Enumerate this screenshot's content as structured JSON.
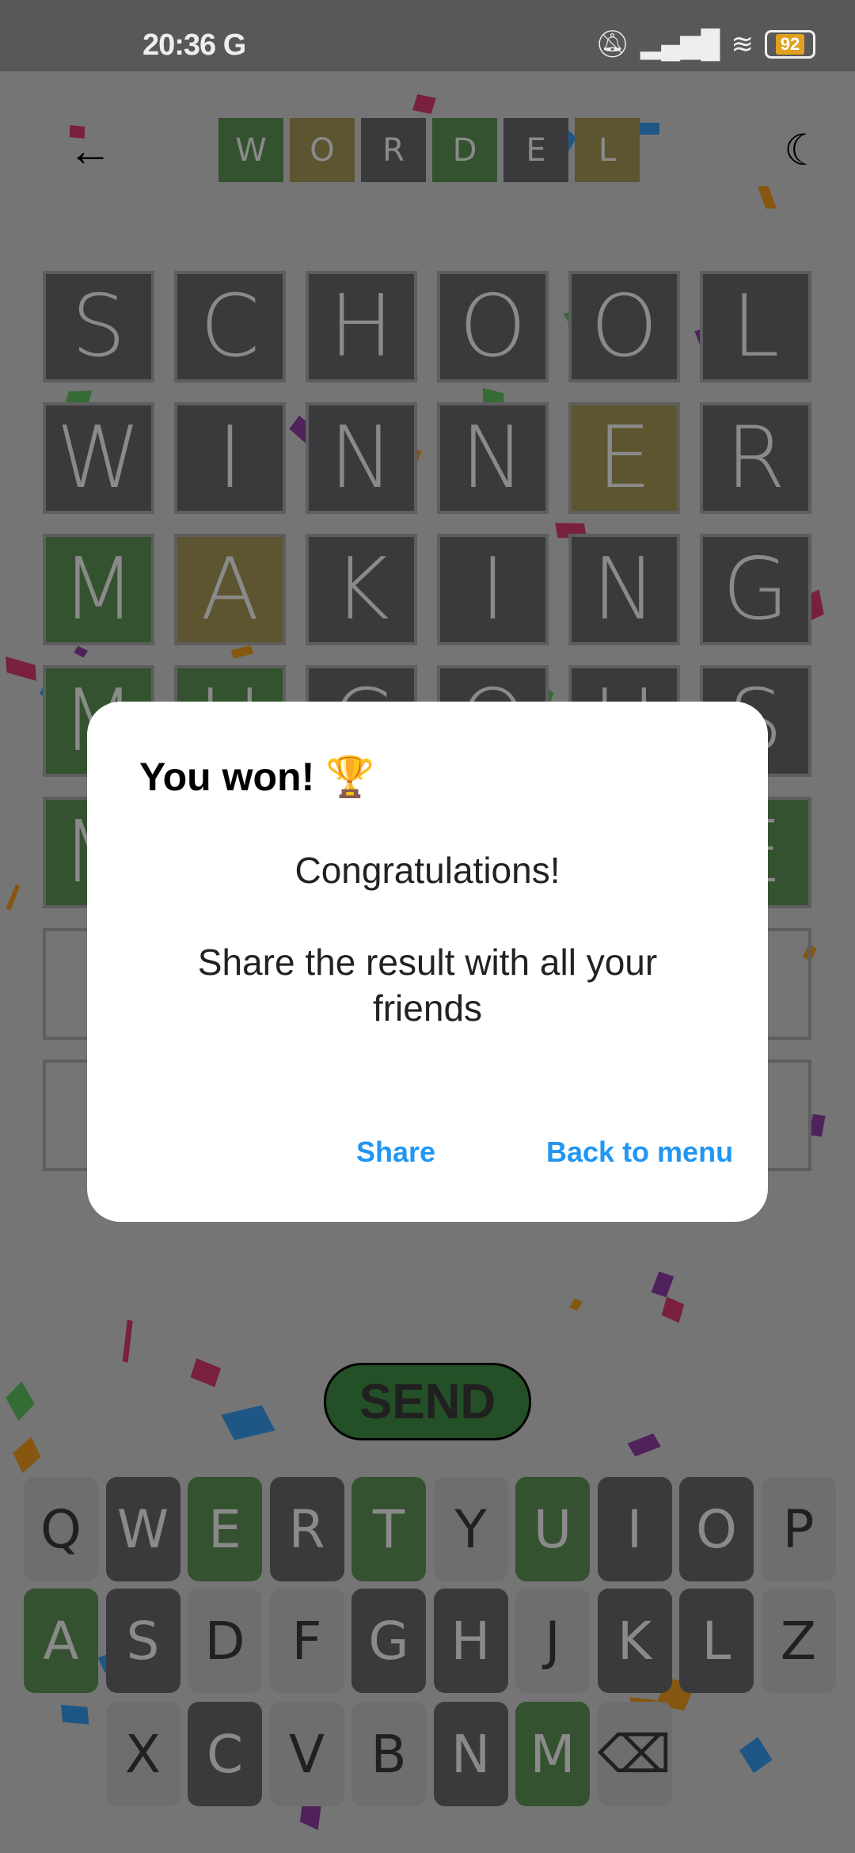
{
  "status_bar": {
    "time": "20:36",
    "carrier_icon": "G",
    "battery": "92"
  },
  "header": {
    "back_icon": "←",
    "moon_icon": "☾",
    "logo_letters": [
      {
        "l": "W",
        "s": "green"
      },
      {
        "l": "O",
        "s": "yellow"
      },
      {
        "l": "R",
        "s": "dark"
      },
      {
        "l": "D",
        "s": "green"
      },
      {
        "l": "E",
        "s": "dark"
      },
      {
        "l": "L",
        "s": "yellow"
      }
    ]
  },
  "grid": [
    [
      {
        "l": "S",
        "s": "dark"
      },
      {
        "l": "C",
        "s": "dark"
      },
      {
        "l": "H",
        "s": "dark"
      },
      {
        "l": "O",
        "s": "dark"
      },
      {
        "l": "O",
        "s": "dark"
      },
      {
        "l": "L",
        "s": "dark"
      }
    ],
    [
      {
        "l": "W",
        "s": "dark"
      },
      {
        "l": "I",
        "s": "dark"
      },
      {
        "l": "N",
        "s": "dark"
      },
      {
        "l": "N",
        "s": "dark"
      },
      {
        "l": "E",
        "s": "yellow"
      },
      {
        "l": "R",
        "s": "dark"
      }
    ],
    [
      {
        "l": "M",
        "s": "green"
      },
      {
        "l": "A",
        "s": "yellow"
      },
      {
        "l": "K",
        "s": "dark"
      },
      {
        "l": "I",
        "s": "dark"
      },
      {
        "l": "N",
        "s": "dark"
      },
      {
        "l": "G",
        "s": "dark"
      }
    ],
    [
      {
        "l": "M",
        "s": "green"
      },
      {
        "l": "U",
        "s": "green"
      },
      {
        "l": "C",
        "s": "dark"
      },
      {
        "l": "O",
        "s": "dark"
      },
      {
        "l": "U",
        "s": "dark"
      },
      {
        "l": "S",
        "s": "dark"
      }
    ],
    [
      {
        "l": "M",
        "s": "green"
      },
      {
        "l": "",
        "s": "green"
      },
      {
        "l": "",
        "s": "green"
      },
      {
        "l": "",
        "s": "green"
      },
      {
        "l": "",
        "s": "green"
      },
      {
        "l": "E",
        "s": "green"
      }
    ],
    [
      {
        "l": "",
        "s": "empty"
      },
      {
        "l": "",
        "s": "empty"
      },
      {
        "l": "",
        "s": "empty"
      },
      {
        "l": "",
        "s": "empty"
      },
      {
        "l": "",
        "s": "empty"
      },
      {
        "l": "",
        "s": "empty"
      }
    ],
    [
      {
        "l": "",
        "s": "empty"
      },
      {
        "l": "",
        "s": "empty"
      },
      {
        "l": "",
        "s": "empty"
      },
      {
        "l": "",
        "s": "empty"
      },
      {
        "l": "",
        "s": "empty"
      },
      {
        "l": "",
        "s": "empty"
      }
    ]
  ],
  "send_label": "SEND",
  "keyboard": [
    [
      {
        "l": "Q",
        "s": "light"
      },
      {
        "l": "W",
        "s": "dark"
      },
      {
        "l": "E",
        "s": "green"
      },
      {
        "l": "R",
        "s": "dark"
      },
      {
        "l": "T",
        "s": "green"
      },
      {
        "l": "Y",
        "s": "light"
      },
      {
        "l": "U",
        "s": "green"
      },
      {
        "l": "I",
        "s": "dark"
      },
      {
        "l": "O",
        "s": "dark"
      },
      {
        "l": "P",
        "s": "light"
      }
    ],
    [
      {
        "l": "A",
        "s": "green"
      },
      {
        "l": "S",
        "s": "dark"
      },
      {
        "l": "D",
        "s": "light"
      },
      {
        "l": "F",
        "s": "light"
      },
      {
        "l": "G",
        "s": "dark"
      },
      {
        "l": "H",
        "s": "dark"
      },
      {
        "l": "J",
        "s": "light"
      },
      {
        "l": "K",
        "s": "dark"
      },
      {
        "l": "L",
        "s": "dark"
      },
      {
        "l": "Z",
        "s": "light"
      }
    ],
    [
      {
        "l": "X",
        "s": "light"
      },
      {
        "l": "C",
        "s": "dark"
      },
      {
        "l": "V",
        "s": "light"
      },
      {
        "l": "B",
        "s": "light"
      },
      {
        "l": "N",
        "s": "dark"
      },
      {
        "l": "M",
        "s": "green"
      },
      {
        "l": "⌫",
        "s": "light"
      }
    ]
  ],
  "dialog": {
    "title": "You won! 🏆",
    "congrats": "Congratulations!",
    "message": "Share the result with all your friends",
    "share": "Share",
    "back_to_menu": "Back to menu"
  },
  "colors": {
    "accent": "#2196F3",
    "green": "#355230",
    "yellow": "#5d5530",
    "dark": "#3a3a3c"
  }
}
